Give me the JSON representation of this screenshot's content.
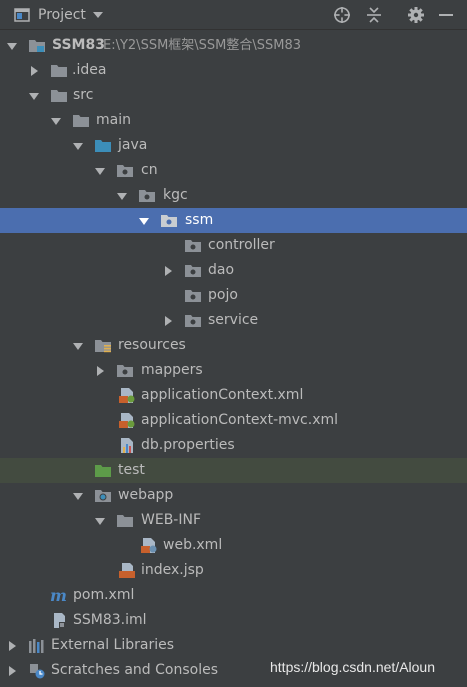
{
  "toolbar": {
    "title": "Project",
    "title_icon": "project-window-icon",
    "dropdown_icon": "chevron-down-icon",
    "icons": [
      "locate-icon",
      "collapse-all-icon",
      "gear-icon",
      "minimize-icon"
    ]
  },
  "tree": {
    "root": {
      "name": "SSM83",
      "path": "E:\\Y2\\SSM框架\\SSM整合\\SSM83"
    },
    "idea": "idea",
    "src": "src",
    "main": "main",
    "java": "java",
    "cn": "cn",
    "kgc": "kgc",
    "ssm": "ssm",
    "controller": "controller",
    "dao": "dao",
    "pojo": "pojo",
    "service": "service",
    "resources": "resources",
    "mappers": "mappers",
    "app_ctx": "applicationContext.xml",
    "app_ctx_mvc": "applicationContext-mvc.xml",
    "db_props": "db.properties",
    "test": "test",
    "webapp": "webapp",
    "web_inf": "WEB-INF",
    "web_xml": "web.xml",
    "index_jsp": "index.jsp",
    "pom": "pom.xml",
    "iml": "SSM83.iml",
    "ext_libs": "External Libraries",
    "scratches": "Scratches and Consoles"
  },
  "colors": {
    "background": "#3c3f41",
    "selection": "#4b6eaf",
    "folder": "#8c9197",
    "source_folder": "#3c8eb9",
    "test_folder": "#5d9b49"
  },
  "watermark": "https://blog.csdn.net/Aloun"
}
